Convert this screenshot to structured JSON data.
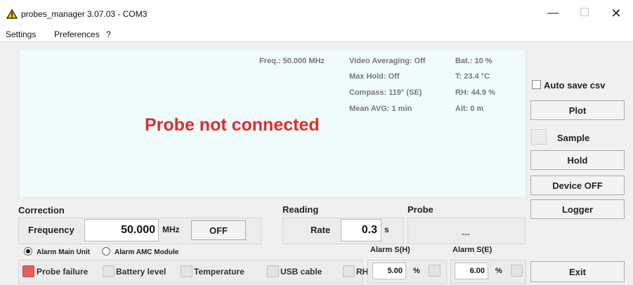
{
  "window": {
    "title": "probes_manager 3.07.03 - COM3",
    "minimize_label": "—",
    "maximize_label": "☐",
    "close_label": "✕"
  },
  "menu": [
    "Settings",
    "Preferences",
    "?"
  ],
  "display": {
    "frequency": "Freq.: 50.000 MHz",
    "video_averaging": "Video Averaging: Off",
    "max_hold": "Max Hold: Off",
    "compass": "Compass: 119° (SE)",
    "mean_avg": "Mean AVG: 1 min",
    "battery": "Bat.:  10 %",
    "temperature": "T: 23.4 °C",
    "humidity": "RH: 44.9 %",
    "altitude": "Alt: 0 m",
    "status_message": "Probe not connected"
  },
  "correction": {
    "section_label": "Correction",
    "frequency_label": "Frequency",
    "frequency_value": "50.000",
    "frequency_unit": "MHz",
    "off_button": "OFF"
  },
  "reading": {
    "section_label": "Reading",
    "rate_label": "Rate",
    "rate_value": "0.3",
    "rate_unit": "s"
  },
  "probe": {
    "section_label": "Probe",
    "value": "---"
  },
  "alarm_source": {
    "main_unit": "Alarm Main Unit",
    "amc_module": "Alarm AMC Module",
    "selected": "Alarm Main Unit"
  },
  "alarms": {
    "probe_failure": "Probe failure",
    "battery_level": "Battery level",
    "temperature": "Temperature",
    "usb_cable": "USB cable",
    "rh": "RH",
    "alarm_sh_label": "Alarm S(H)",
    "alarm_sh_value": "5.00",
    "alarm_sh_unit": "%",
    "alarm_se_label": "Alarm S(E)",
    "alarm_se_value": "6.00",
    "alarm_se_unit": "%"
  },
  "side": {
    "auto_save": "Auto save csv",
    "plot": "Plot",
    "sample": "Sample",
    "hold": "Hold",
    "device_off": "Device OFF",
    "logger": "Logger",
    "exit": "Exit"
  },
  "colors": {
    "status_message": "#e02c2c",
    "display_background": "#f0fbfb",
    "probe_failure_indicator": "#e06060",
    "warning_icon": "#f2c200"
  }
}
